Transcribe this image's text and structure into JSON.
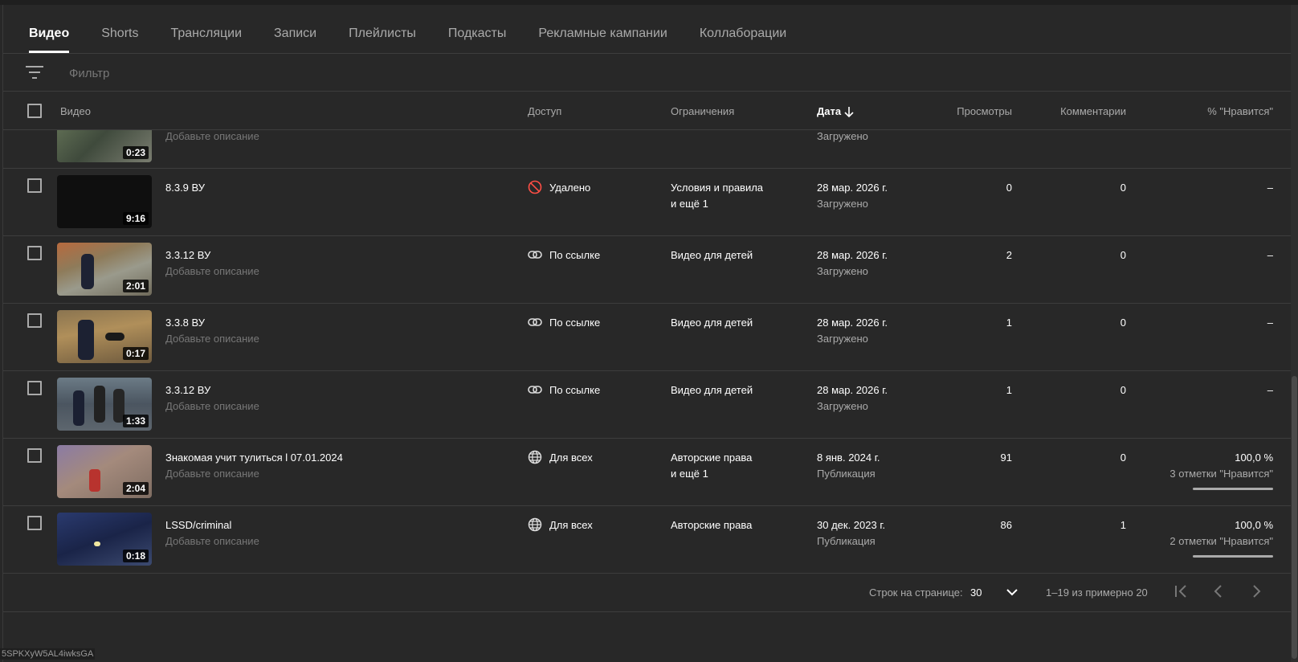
{
  "tabs": [
    "Видео",
    "Shorts",
    "Трансляции",
    "Записи",
    "Плейлисты",
    "Подкасты",
    "Рекламные кампании",
    "Коллаборации"
  ],
  "filter": {
    "placeholder": "Фильтр",
    "icon": "filter-icon"
  },
  "columns": {
    "video": "Видео",
    "access": "Доступ",
    "restrictions": "Ограничения",
    "date": "Дата",
    "views": "Просмотры",
    "comments": "Комментарии",
    "likes": "% \"Нравится\""
  },
  "partial_row": {
    "duration": "0:23",
    "description": "Добавьте описание",
    "date_status": "Загружено"
  },
  "rows": [
    {
      "title": "8.3.9 ВУ",
      "description": "",
      "duration": "9:16",
      "visibility": "Удалено",
      "visibility_icon": "blocked-icon",
      "restriction": "Условия и правила",
      "restriction_extra": "и ещё 1",
      "date": "28 мар. 2026 г.",
      "date_status": "Загружено",
      "views": "0",
      "comments": "0",
      "likes": "–",
      "likes_count": "",
      "likes_ratio": null
    },
    {
      "title": "3.3.12 ВУ",
      "description": "Добавьте описание",
      "duration": "2:01",
      "visibility": "По ссылке",
      "visibility_icon": "link-icon",
      "restriction": "Видео для детей",
      "restriction_extra": "",
      "date": "28 мар. 2026 г.",
      "date_status": "Загружено",
      "views": "2",
      "comments": "0",
      "likes": "–",
      "likes_count": "",
      "likes_ratio": null
    },
    {
      "title": "3.3.8 ВУ",
      "description": "Добавьте описание",
      "duration": "0:17",
      "visibility": "По ссылке",
      "visibility_icon": "link-icon",
      "restriction": "Видео для детей",
      "restriction_extra": "",
      "date": "28 мар. 2026 г.",
      "date_status": "Загружено",
      "views": "1",
      "comments": "0",
      "likes": "–",
      "likes_count": "",
      "likes_ratio": null
    },
    {
      "title": "3.3.12 ВУ",
      "description": "Добавьте описание",
      "duration": "1:33",
      "visibility": "По ссылке",
      "visibility_icon": "link-icon",
      "restriction": "Видео для детей",
      "restriction_extra": "",
      "date": "28 мар. 2026 г.",
      "date_status": "Загружено",
      "views": "1",
      "comments": "0",
      "likes": "–",
      "likes_count": "",
      "likes_ratio": null
    },
    {
      "title": "Знакомая учит тулиться l 07.01.2024",
      "description": "Добавьте описание",
      "duration": "2:04",
      "visibility": "Для всех",
      "visibility_icon": "globe-icon",
      "restriction": "Авторские права",
      "restriction_extra": "и ещё 1",
      "date": "8 янв. 2024 г.",
      "date_status": "Публикация",
      "views": "91",
      "comments": "0",
      "likes": "100,0 %",
      "likes_count": "3 отметки \"Нравится\"",
      "likes_ratio": 1.0
    },
    {
      "title": "LSSD/criminal",
      "description": "Добавьте описание",
      "duration": "0:18",
      "visibility": "Для всех",
      "visibility_icon": "globe-icon",
      "restriction": "Авторские права",
      "restriction_extra": "",
      "date": "30 дек. 2023 г.",
      "date_status": "Публикация",
      "views": "86",
      "comments": "1",
      "likes": "100,0 %",
      "likes_count": "2 отметки \"Нравится\"",
      "likes_ratio": 1.0
    }
  ],
  "pagination": {
    "rows_label": "Строк на странице:",
    "rows_value": "30",
    "range": "1–19 из примерно 20"
  },
  "status_url": "5SPKXyW5AL4iwksGA",
  "colors": {
    "background": "#282828",
    "blocked": "#ff4e45",
    "text_secondary": "#aaaaaa"
  }
}
